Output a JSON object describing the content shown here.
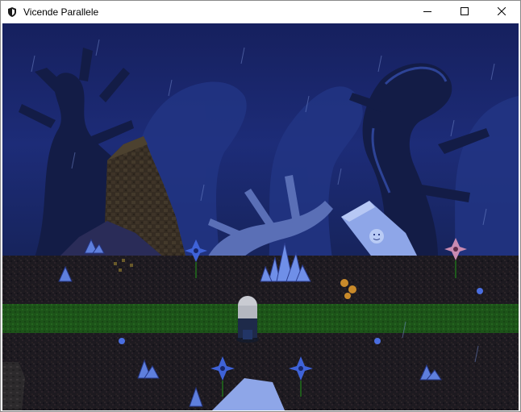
{
  "window": {
    "title": "Vicende Parallele",
    "controls": [
      "minimize",
      "maximize",
      "close"
    ]
  },
  "icons": {
    "app": "shield-icon",
    "minimize": "minimize-icon",
    "maximize": "maximize-icon",
    "close": "close-icon"
  },
  "colors": {
    "sky": "#1b2a72",
    "tree": "#141d4a",
    "dirt": "#1e1a22",
    "grass": "#1f5a1c",
    "crystal": "#6f8fe8",
    "flower_blue": "#3f63d8",
    "flower_pink": "#c98ab1",
    "pillar_stone": "#3b3226"
  }
}
